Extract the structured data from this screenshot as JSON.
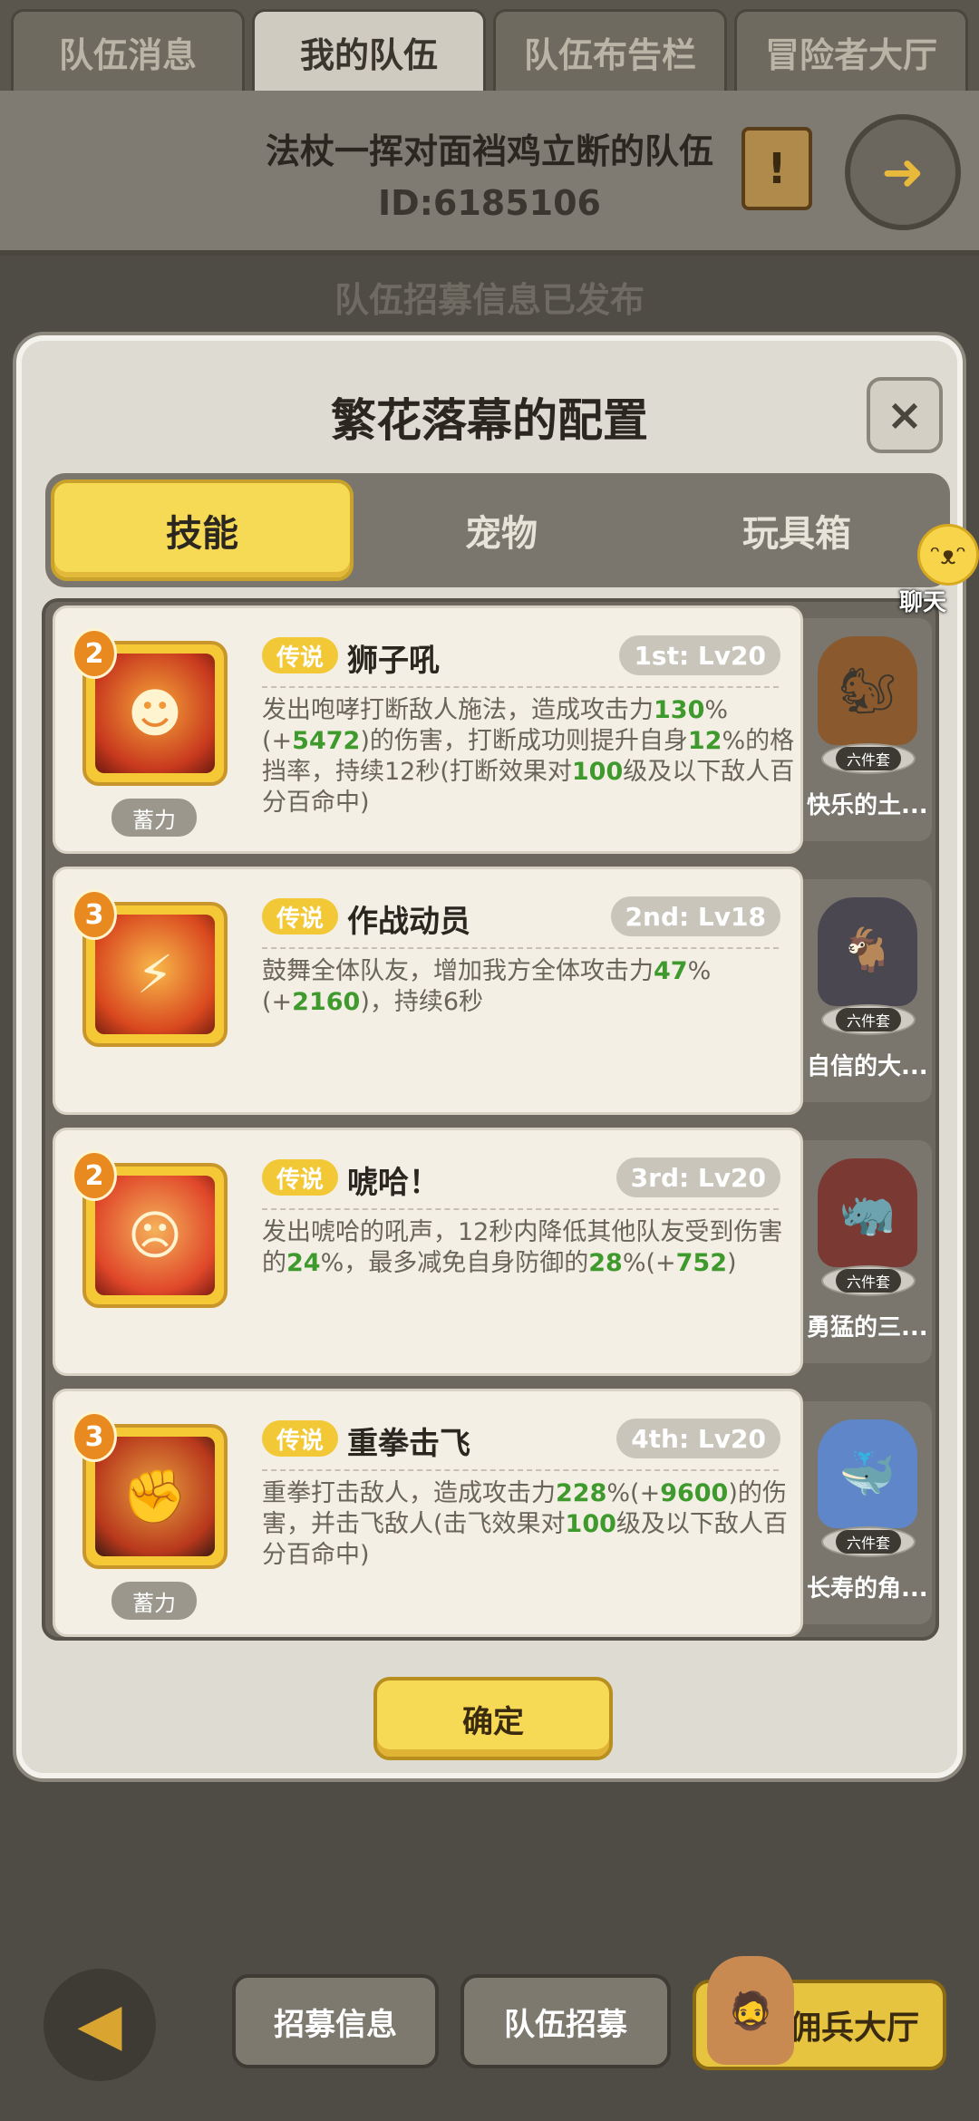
{
  "top_tabs": [
    {
      "label": "队伍消息",
      "active": false
    },
    {
      "label": "我的队伍",
      "active": true
    },
    {
      "label": "队伍布告栏",
      "active": false
    },
    {
      "label": "冒险者大厅",
      "active": false
    }
  ],
  "team": {
    "name": "法杖一挥对面裆鸡立断的队伍",
    "id": "ID:6185106"
  },
  "recruit_status": "队伍招募信息已发布",
  "modal": {
    "title": "繁花落幕的配置",
    "close_label": "×",
    "tabs": [
      {
        "label": "技能",
        "active": true
      },
      {
        "label": "宠物",
        "active": false
      },
      {
        "label": "玩具箱",
        "active": false
      }
    ],
    "chat_label": "聊天",
    "confirm_label": "确定"
  },
  "skills": [
    {
      "badge": "2",
      "tag": "传说",
      "name": "狮子吼",
      "level": "1st: Lv20",
      "charge": "蓄力",
      "desc": [
        "发出咆哮打断敌人施法，造成攻击力",
        "130",
        "%(+",
        "5472",
        ")的伤害，打断成功则提升自身",
        "12",
        "%的格挡率，持续12秒(打断效果对",
        "100",
        "级及以下敌人百分百命中)"
      ],
      "pet_name": "快乐的土...",
      "pet_set": "六件套"
    },
    {
      "badge": "3",
      "tag": "传说",
      "name": "作战动员",
      "level": "2nd: Lv18",
      "charge": "",
      "desc": [
        "鼓舞全体队友，增加我方全体攻击力",
        "47",
        "%(+",
        "2160",
        ")，持续6秒",
        "",
        "",
        "",
        ""
      ],
      "pet_name": "自信的大...",
      "pet_set": "六件套"
    },
    {
      "badge": "2",
      "tag": "传说",
      "name": "唬哈！",
      "level": "3rd: Lv20",
      "charge": "",
      "desc": [
        "发出唬哈的吼声，12秒内降低其他队友受到伤害的",
        "24",
        "%，最多减免自身防御的",
        "28",
        "%(+",
        "752",
        ")",
        "",
        ""
      ],
      "pet_name": "勇猛的三...",
      "pet_set": "六件套"
    },
    {
      "badge": "3",
      "tag": "传说",
      "name": "重拳击飞",
      "level": "4th: Lv20",
      "charge": "蓄力",
      "desc": [
        "重拳打击敌人，造成攻击力",
        "228",
        "%(+",
        "9600",
        ")的伤害，并击飞敌人(击飞效果对",
        "100",
        "级及以下敌人百分百命中)",
        "",
        ""
      ],
      "pet_name": "长寿的角...",
      "pet_set": "六件套"
    }
  ],
  "bottom": {
    "back_label": "◀",
    "recruit_info": "招募信息",
    "team_recruit": "队伍招募",
    "mercenary_hall": "佣兵大厅"
  }
}
